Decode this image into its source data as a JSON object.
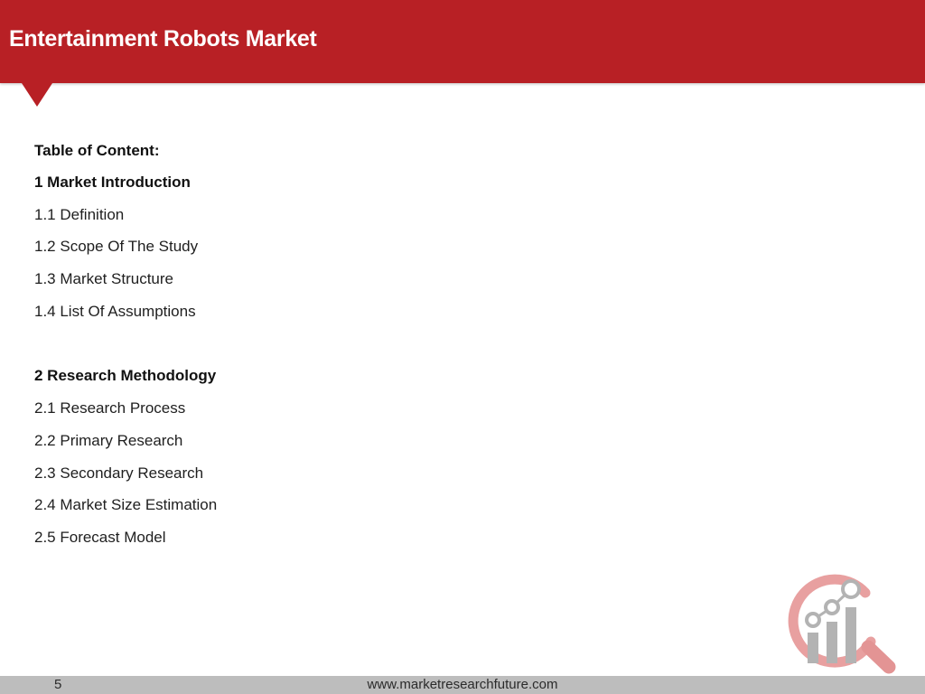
{
  "header": {
    "title": "Entertainment Robots Market"
  },
  "toc": {
    "heading": "Table of Content:",
    "sections": [
      {
        "title": "1 Market Introduction",
        "items": [
          "1.1 Definition",
          "1.2 Scope Of The Study",
          "1.3 Market Structure",
          "1.4 List Of Assumptions"
        ]
      },
      {
        "title": "2 Research Methodology",
        "items": [
          "2.1 Research Process",
          "2.2 Primary Research",
          "2.3 Secondary Research",
          "2.4 Market Size Estimation",
          "2.5 Forecast Model"
        ]
      }
    ]
  },
  "logo": {
    "icon": "magnifier-chart-icon",
    "accent_color": "#e08585",
    "bar_color": "#b3b3b3"
  },
  "footer": {
    "page_number": "5",
    "url": "www.marketresearchfuture.com"
  },
  "colors": {
    "brand_red": "#b82025",
    "footer_gray": "#bdbdbd"
  }
}
